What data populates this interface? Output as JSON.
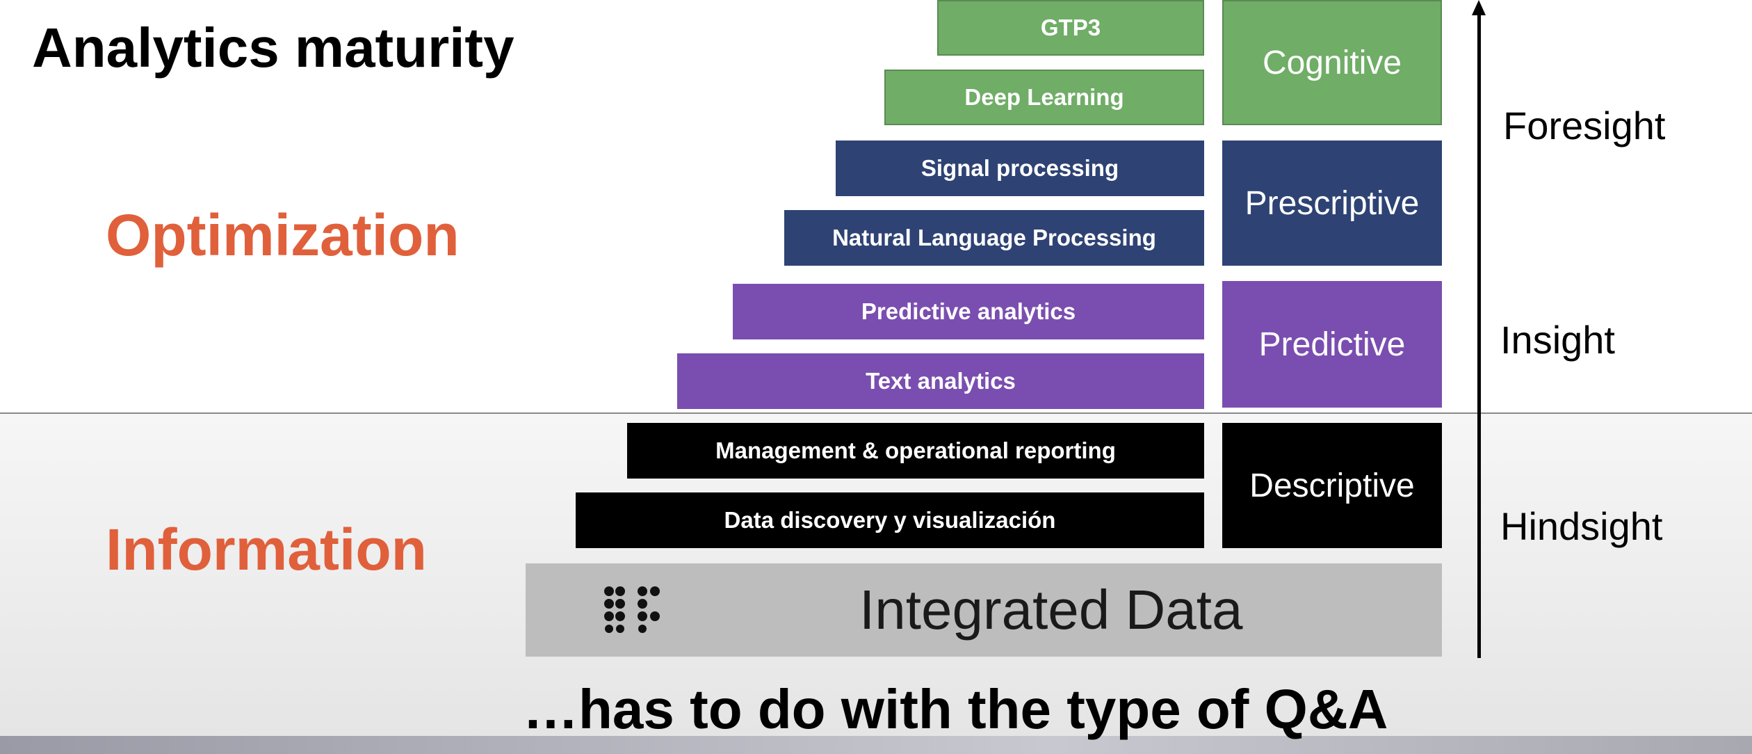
{
  "title": "Analytics maturity",
  "side_labels": {
    "upper": "Optimization",
    "lower": "Information"
  },
  "techniques": [
    "GTP3",
    "Deep Learning",
    "Signal processing",
    "Natural Language Processing",
    "Predictive analytics",
    "Text analytics",
    "Management & operational reporting",
    "Data discovery y visualización"
  ],
  "categories": [
    "Cognitive",
    "Prescriptive",
    "Predictive",
    "Descriptive"
  ],
  "foundation": {
    "label": "Integrated Data",
    "icon": "braille-dots-icon"
  },
  "stages": {
    "top": "Foresight",
    "middle": "Insight",
    "bottom": "Hindsight"
  },
  "footer": "…has to do with the type of Q&A",
  "colors": {
    "cognitive": "#70ad67",
    "prescriptive": "#2e4374",
    "predictive": "#7a4eb0",
    "descriptive": "#000000",
    "foundation": "#bdbdbd",
    "side_label": "#e0603b"
  }
}
